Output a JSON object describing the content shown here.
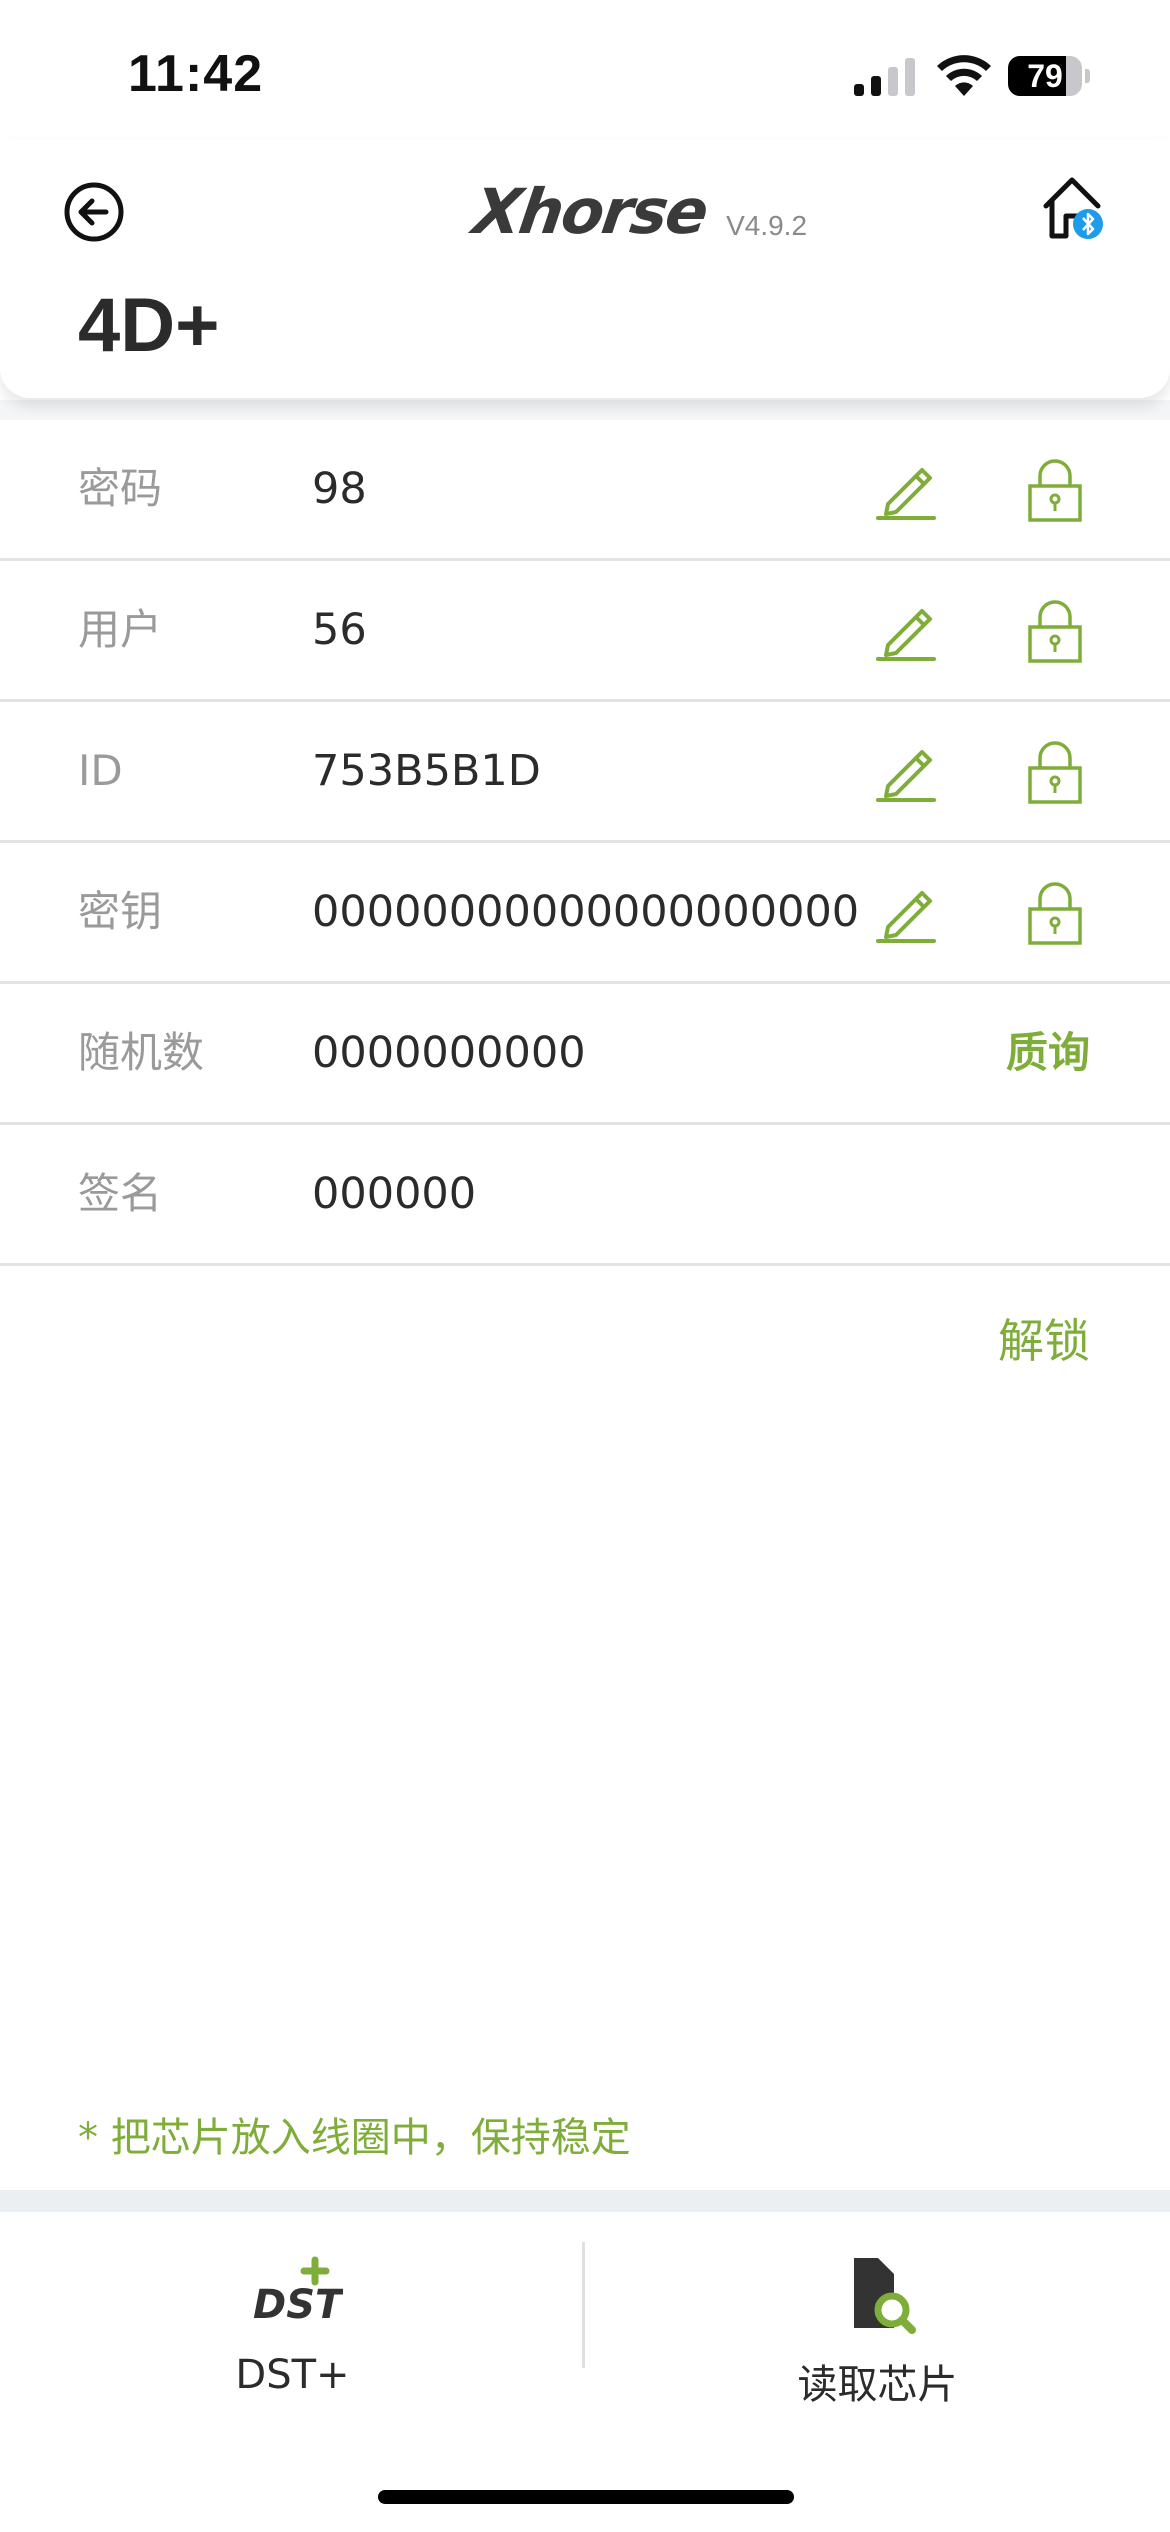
{
  "status_bar": {
    "time": "11:42",
    "battery_level": "79",
    "battery_fraction": 0.79,
    "icons": [
      "cellular-signal-icon",
      "wifi-icon",
      "battery-icon"
    ]
  },
  "header": {
    "brand": "Xhorse",
    "version": "V4.9.2",
    "title": "4D+",
    "back_icon": "back-arrow-circle-icon",
    "home_icon": "home-bluetooth-icon"
  },
  "rows": [
    {
      "label": "密码",
      "value": "98",
      "editable": true,
      "lockable": true
    },
    {
      "label": "用户",
      "value": "56",
      "editable": true,
      "lockable": true
    },
    {
      "label": "ID",
      "value": "753B5B1D",
      "editable": true,
      "lockable": true
    },
    {
      "label": "密钥",
      "value": "00000000000000000000",
      "editable": true,
      "lockable": true
    },
    {
      "label": "随机数",
      "value": "0000000000",
      "action": "质询"
    },
    {
      "label": "签名",
      "value": "000000"
    }
  ],
  "actions": {
    "unlock": "解锁"
  },
  "hint": "* 把芯片放入线圈中，保持稳定",
  "toolbar": {
    "left_label": "DST+",
    "right_label": "读取芯片",
    "left_icon": "dst-plus-icon",
    "right_icon": "read-chip-icon"
  },
  "colors": {
    "accent": "#7fad3a",
    "text": "#2b2b2b",
    "label": "#9a9a9a",
    "bluetooth": "#1e9be9"
  }
}
